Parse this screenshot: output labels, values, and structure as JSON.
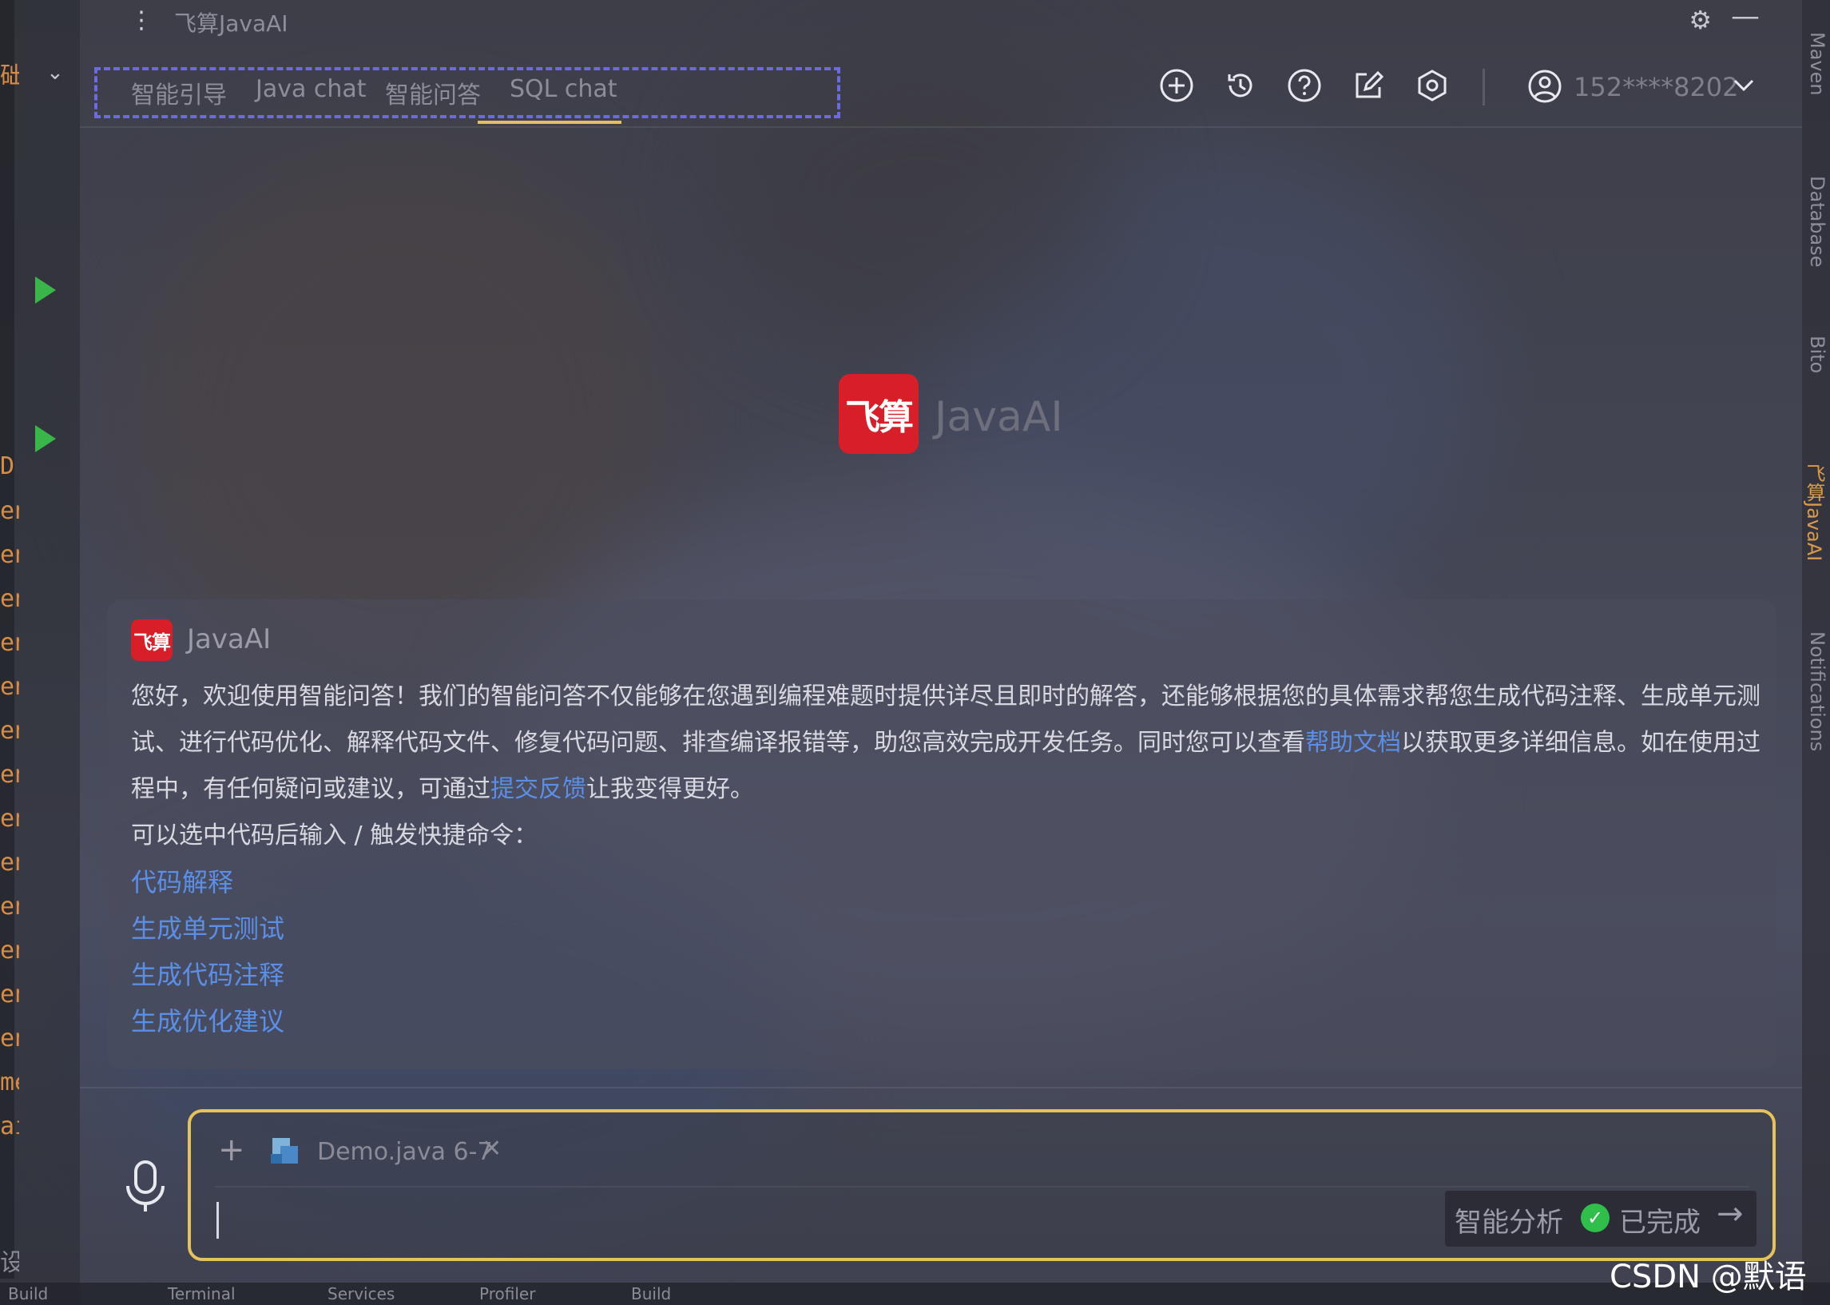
{
  "window": {
    "title": "飞算JavaAI"
  },
  "tabs": [
    {
      "label": "智能引导"
    },
    {
      "label": "Java chat"
    },
    {
      "label": "智能问答",
      "active": true
    },
    {
      "label": "SQL chat"
    }
  ],
  "toolbar": {
    "icons": [
      "new-chat-icon",
      "history-icon",
      "help-icon",
      "edit-icon",
      "settings-icon"
    ],
    "user": {
      "phone": "152****8202"
    }
  },
  "left_gutter": {
    "fragments": [
      "础",
      "D",
      "en",
      "en",
      "en",
      "en",
      "en",
      "en",
      "en",
      "en",
      "en",
      "en",
      "en",
      "en",
      "en",
      "me",
      "ai",
      "设计"
    ]
  },
  "right_tool_windows": [
    {
      "label": "Maven"
    },
    {
      "label": "Database"
    },
    {
      "label": "Bito"
    },
    {
      "label": "飞算JavaAI",
      "active": true
    },
    {
      "label": "Notifications"
    }
  ],
  "hero": {
    "logo": "飞算",
    "name": "JavaAI"
  },
  "message": {
    "sender": "JavaAI",
    "avatar": "飞算",
    "intro_prefix": "您好，欢迎使用智能问答！我们的智能问答不仅能够在您遇到编程难题时提供详尽且即时的解答，还能够根据您的具体需求帮您生成代码注释、生成单元测试、进行代码优化、解释代码文件、修复代码问题、排查编译报错等，助您高效完成开发任务。同时您可以查看",
    "help_link": "帮助文档",
    "intro_middle": "以获取更多详细信息。如在使用过程中，有任何疑问或建议，可通过",
    "feedback_link": "提交反馈",
    "intro_suffix": "让我变得更好。",
    "hint": "可以选中代码后输入 / 触发快捷命令：",
    "commands": [
      "代码解释",
      "生成单元测试",
      "生成代码注释",
      "生成优化建议"
    ]
  },
  "input": {
    "file_chip": "Demo.java 6-7",
    "status_label": "智能分析",
    "status_done": "已完成"
  },
  "bottom_bar": {
    "items": [
      "Build",
      "Terminal",
      "Services",
      "Profiler",
      "Build"
    ]
  },
  "watermark": "CSDN @默语",
  "colors": {
    "accent_underline": "#e0c060",
    "tab_border": "#6c6ae0",
    "link": "#5b8fe6",
    "brand_red": "#d81e28",
    "success": "#2fbf4a",
    "input_border": "#e6c25a"
  }
}
